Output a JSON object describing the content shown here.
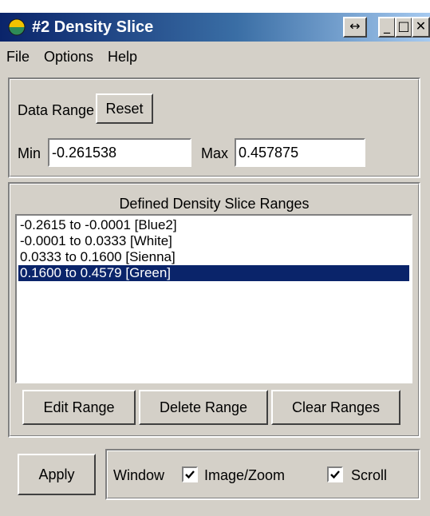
{
  "window": {
    "title": "#2 Density Slice",
    "resize_glyph": "↔",
    "minimize_glyph": "_",
    "maximize_glyph": "□",
    "close_glyph": "✕",
    "icon": "idl-app-icon"
  },
  "menu": [
    "File",
    "Options",
    "Help"
  ],
  "data_range": {
    "label": "Data Range",
    "reset_label": "Reset",
    "min_label": "Min",
    "min_value": "-0.261538",
    "max_label": "Max",
    "max_value": "0.457875"
  },
  "slices": {
    "heading": "Defined Density Slice Ranges",
    "items": [
      "-0.2615 to -0.0001 [Blue2]",
      "-0.0001 to 0.0333 [White]",
      "0.0333 to 0.1600 [Sienna]",
      "0.1600 to 0.4579 [Green]"
    ],
    "selected_index": 3,
    "edit_label": "Edit Range",
    "delete_label": "Delete Range",
    "clear_label": "Clear Ranges"
  },
  "footer": {
    "apply_label": "Apply",
    "window_label": "Window",
    "image_zoom_label": "Image/Zoom",
    "image_zoom_checked": true,
    "scroll_label": "Scroll",
    "scroll_checked": true
  },
  "colors": {
    "titlebar_start": "#0a246a",
    "titlebar_end": "#a6caf0",
    "selection": "#0a246a",
    "face": "#d4d0c8"
  }
}
